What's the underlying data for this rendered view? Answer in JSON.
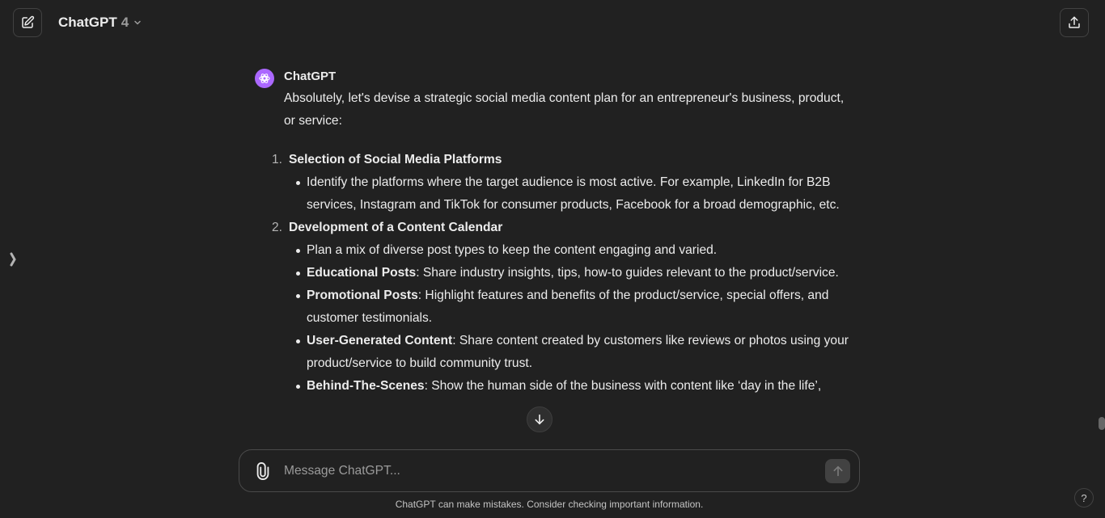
{
  "header": {
    "model_name": "ChatGPT",
    "model_version": "4"
  },
  "message": {
    "sender": "ChatGPT",
    "intro": "Absolutely, let's devise a strategic social media content plan for an entrepreneur's business, product, or service:",
    "sections": [
      {
        "number": "1.",
        "heading": "Selection of Social Media Platforms",
        "bullets": [
          {
            "bold": "",
            "text": "Identify the platforms where the target audience is most active. For example, LinkedIn for B2B services, Instagram and TikTok for consumer products, Facebook for a broad demographic, etc."
          }
        ]
      },
      {
        "number": "2.",
        "heading": "Development of a Content Calendar",
        "bullets": [
          {
            "bold": "",
            "text": "Plan a mix of diverse post types to keep the content engaging and varied."
          },
          {
            "bold": "Educational Posts",
            "text": ": Share industry insights, tips, how-to guides relevant to the product/service."
          },
          {
            "bold": "Promotional Posts",
            "text": ": Highlight features and benefits of the product/service, special offers, and customer testimonials."
          },
          {
            "bold": "User-Generated Content",
            "text": ": Share content created by customers like reviews or photos using your product/service to build community trust."
          },
          {
            "bold": "Behind-The-Scenes",
            "text": ": Show the human side of the business with content like ‘day in the life’,"
          }
        ]
      }
    ]
  },
  "composer": {
    "placeholder": "Message ChatGPT..."
  },
  "footer": {
    "disclaimer": "ChatGPT can make mistakes. Consider checking important information.",
    "help_label": "?"
  },
  "icons": {
    "new_chat": "edit-icon",
    "share": "share-icon",
    "model_dropdown": "chevron-down-icon",
    "sidebar": "sidebar-toggle-icon",
    "avatar": "openai-logo-icon",
    "scroll_down": "arrow-down-icon",
    "attach": "paperclip-icon",
    "send": "arrow-up-icon"
  },
  "colors": {
    "background": "#212121",
    "avatar": "#ab68ff"
  }
}
